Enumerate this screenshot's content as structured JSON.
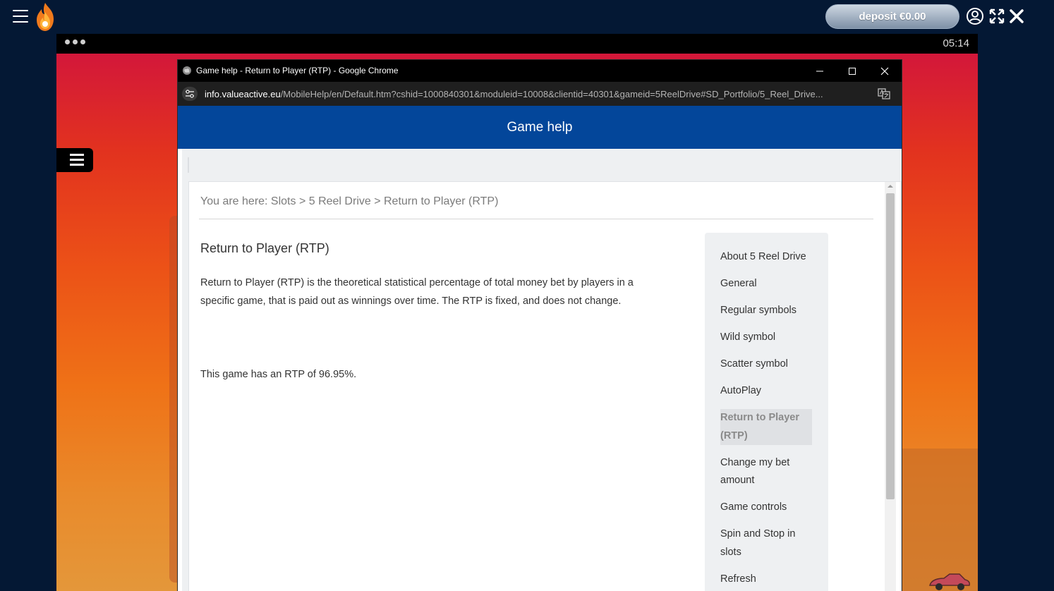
{
  "site": {
    "deposit_label": "deposit €0.00",
    "icons": [
      "menu-icon",
      "flame-logo-icon",
      "user-icon",
      "fullscreen-icon",
      "close-icon"
    ]
  },
  "game": {
    "clock": "05:14"
  },
  "chrome": {
    "window_title": "Game help - Return to Player (RTP) - Google Chrome",
    "url_host": "info.valueactive.eu",
    "url_path": "/MobileHelp/en/Default.htm?cshid=1000840301&moduleid=10008&clientid=40301&gameid=5ReelDrive#SD_Portfolio/5_Reel_Drive..."
  },
  "help": {
    "header_title": "Game help",
    "breadcrumb": "You are here: Slots > 5 Reel Drive > Return to Player (RTP)",
    "content": {
      "title": "Return to Player (RTP)",
      "paragraph": "Return to Player (RTP) is the theoretical statistical percentage of total money bet by players in a specific game, that is paid out as winnings over time. The RTP is fixed, and does not change.",
      "rtp_statement": "This game has an RTP of 96.95%."
    },
    "toc": [
      {
        "label": "About 5 Reel Drive",
        "active": false
      },
      {
        "label": "General",
        "active": false
      },
      {
        "label": "Regular symbols",
        "active": false
      },
      {
        "label": "Wild symbol",
        "active": false
      },
      {
        "label": "Scatter symbol",
        "active": false
      },
      {
        "label": "AutoPlay",
        "active": false
      },
      {
        "label": "Return to Player (RTP)",
        "active": true
      },
      {
        "label": "Change my bet amount",
        "active": false
      },
      {
        "label": "Game controls",
        "active": false
      },
      {
        "label": "Spin and Stop in slots",
        "active": false
      },
      {
        "label": "Refresh",
        "active": false
      }
    ]
  }
}
